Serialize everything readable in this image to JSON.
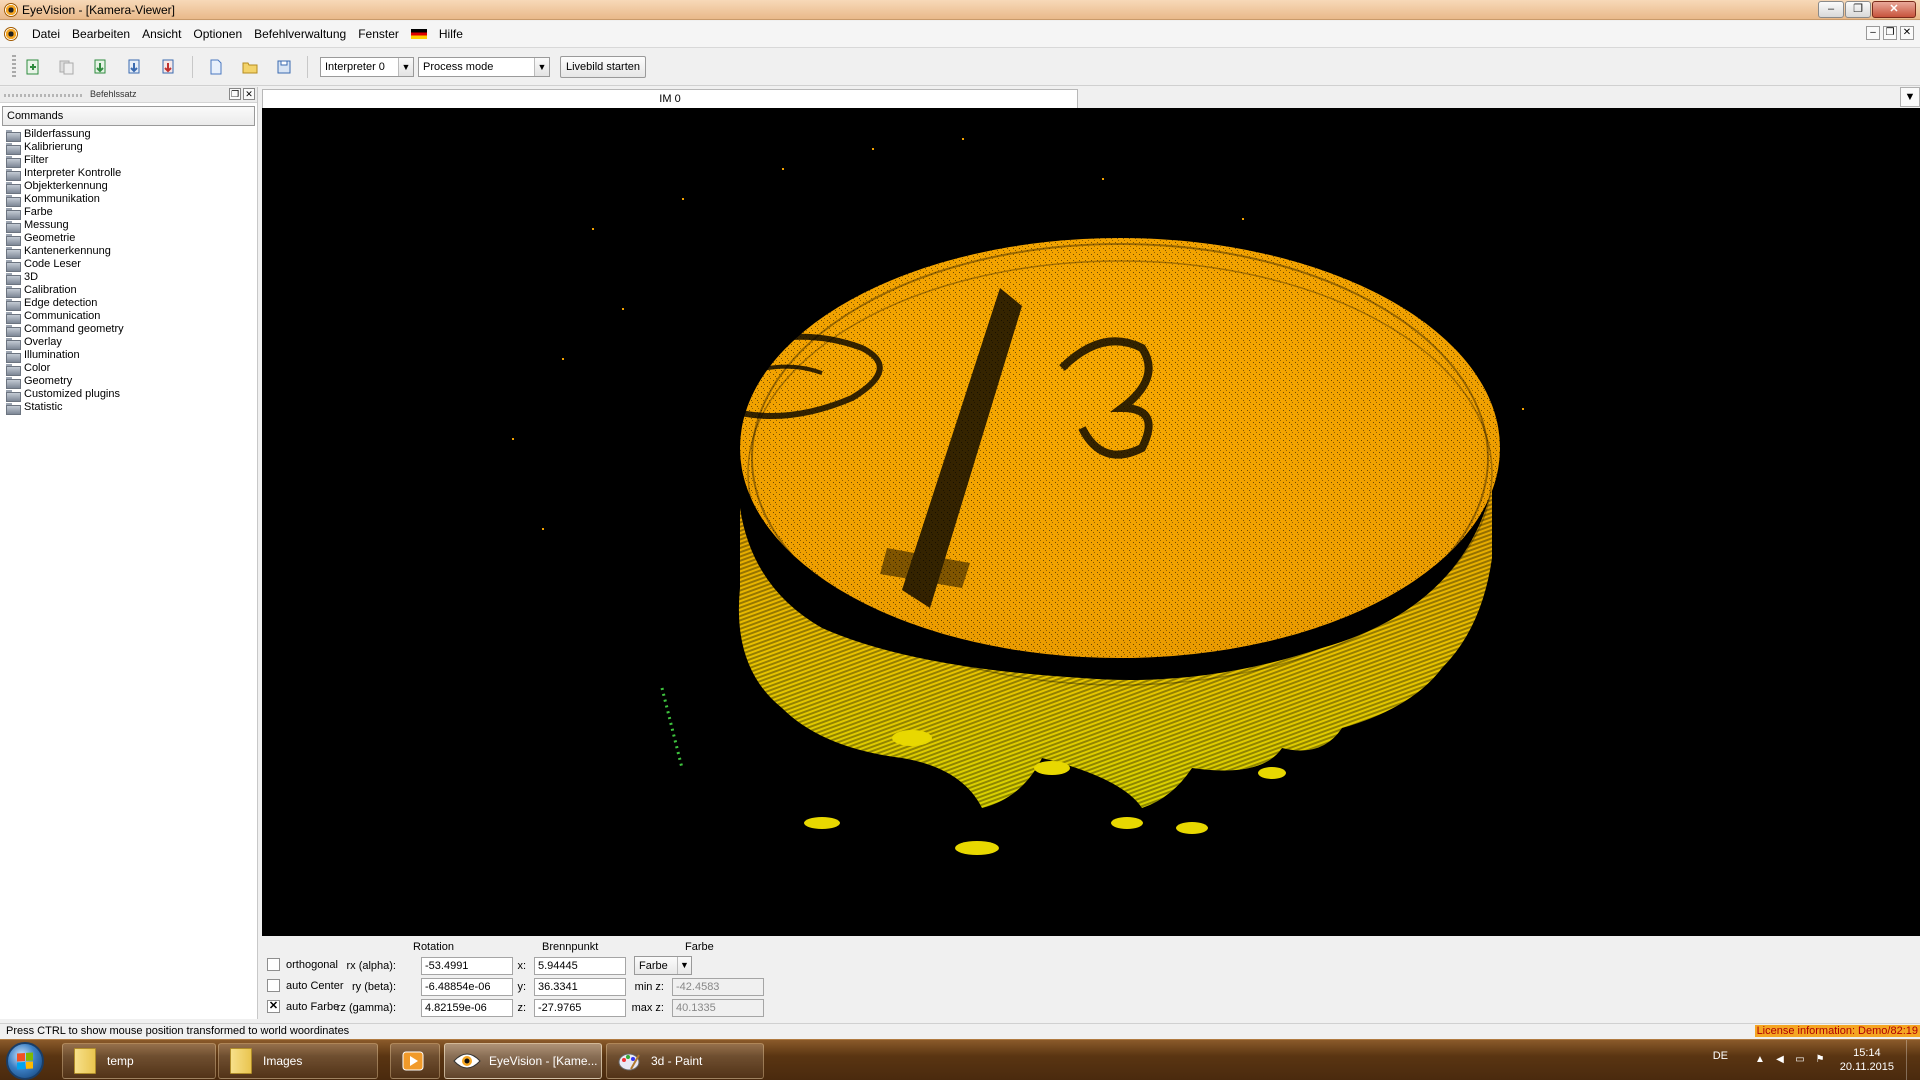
{
  "window": {
    "title": "EyeVision - [Kamera-Viewer]",
    "minimize": "–",
    "restore": "❐",
    "close": "✕"
  },
  "menu": {
    "items": [
      "Datei",
      "Bearbeiten",
      "Ansicht",
      "Optionen",
      "Befehlverwaltung",
      "Fenster",
      "Hilfe"
    ],
    "mdi_minimize": "–",
    "mdi_restore": "❐",
    "mdi_close": "✕"
  },
  "toolbar": {
    "interpreter_value": "Interpreter 0",
    "mode_value": "Process mode",
    "livebild_label": "Livebild starten"
  },
  "dock": {
    "title": "Befehlssatz",
    "float_icon": "❐",
    "close_icon": "✕",
    "commands_header": "Commands",
    "items": [
      "Bilderfassung",
      "Kalibrierung",
      "Filter",
      "Interpreter Kontrolle",
      "Objekterkennung",
      "Kommunikation",
      "Farbe",
      "Messung",
      "Geometrie",
      "Kantenerkennung",
      "Code Leser",
      "3D",
      "Calibration",
      "Edge detection",
      "Communication",
      "Command geometry",
      "Overlay",
      "Illumination",
      "Color",
      "Geometry",
      "Customized plugins",
      "Statistic"
    ]
  },
  "image_tab": {
    "label": "IM 0",
    "menu_arrow": "▼"
  },
  "controls": {
    "rotation_header": "Rotation",
    "brennpunkt_header": "Brennpunkt",
    "farbe_header": "Farbe",
    "orthogonal_label": "orthogonal",
    "orthogonal_checked": false,
    "auto_center_label": "auto Center",
    "auto_center_checked": false,
    "auto_farbe_label": "auto Farbe",
    "auto_farbe_checked": true,
    "rx_label": "rx (alpha):",
    "rx_value": "-53.4991",
    "ry_label": "ry (beta):",
    "ry_value": "-6.48854e-06",
    "rz_label": "rz (gamma):",
    "rz_value": "4.82159e-06",
    "x_label": "x:",
    "x_value": "5.94445",
    "y_label": "y:",
    "y_value": "36.3341",
    "z_label": "z:",
    "z_value": "-27.9765",
    "farbe_value": "Farbe",
    "min_z_label": "min z:",
    "min_z_value": "-42.4583",
    "max_z_label": "max z:",
    "max_z_value": "40.1335"
  },
  "status": {
    "text": "Press CTRL to show mouse position transformed to world woordinates",
    "license": "License information: Demo/82:19"
  },
  "taskbar": {
    "items": [
      {
        "label": "temp",
        "icon": "folder-icon"
      },
      {
        "label": "Images",
        "icon": "folder-icon"
      },
      {
        "label": "",
        "icon": "media-player-icon"
      },
      {
        "label": "EyeVision - [Kame...",
        "icon": "eyevision-icon"
      },
      {
        "label": "3d - Paint",
        "icon": "paint-icon"
      }
    ],
    "language": "DE",
    "time": "15:14",
    "date": "20.11.2015"
  },
  "colors": {
    "accent_orange": "#f5a623",
    "point_cloud_orange": "#f0a000",
    "point_cloud_yellow": "#e8d800",
    "viewport_bg": "#000000",
    "title_bar": "#e9b98a",
    "taskbar": "#5a3512"
  }
}
